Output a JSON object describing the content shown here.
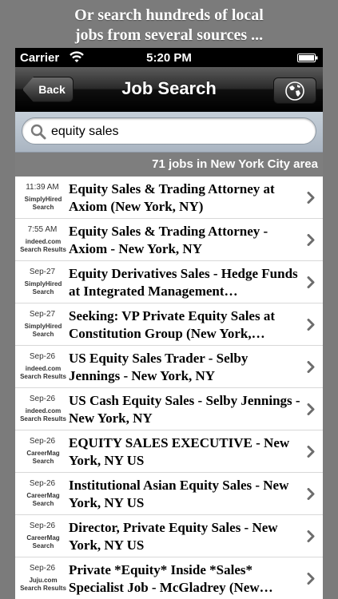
{
  "promo": {
    "line1": "Or search hundreds of local",
    "line2": "jobs from several sources ..."
  },
  "status": {
    "carrier": "Carrier",
    "time": "5:20 PM"
  },
  "nav": {
    "back_label": "Back",
    "title": "Job Search",
    "globe_icon": "globe-icon"
  },
  "search": {
    "value": "equity sales",
    "icon": "magnifier-icon"
  },
  "summary": "71 jobs in New York City area",
  "jobs": [
    {
      "date": "11:39 AM",
      "source1": "SimplyHired",
      "source2": "Search",
      "title": "Equity Sales & Trading Attorney at Axiom (New York, NY)"
    },
    {
      "date": "7:55 AM",
      "source1": "indeed.com",
      "source2": "Search Results",
      "title": "Equity Sales & Trading Attorney - Axiom - New York, NY"
    },
    {
      "date": "Sep-27",
      "source1": "SimplyHired",
      "source2": "Search",
      "title": "Equity Derivatives Sales - Hedge Funds at Integrated Management…"
    },
    {
      "date": "Sep-27",
      "source1": "SimplyHired",
      "source2": "Search",
      "title": "Seeking: VP Private Equity Sales at Constitution Group (New York,…"
    },
    {
      "date": "Sep-26",
      "source1": "indeed.com",
      "source2": "Search Results",
      "title": "US Equity Sales Trader - Selby Jennings - New York, NY"
    },
    {
      "date": "Sep-26",
      "source1": "indeed.com",
      "source2": "Search Results",
      "title": "US Cash Equity Sales - Selby Jennings - New York, NY"
    },
    {
      "date": "Sep-26",
      "source1": "CareerMag",
      "source2": "Search",
      "title": "EQUITY SALES EXECUTIVE - New York, NY US"
    },
    {
      "date": "Sep-26",
      "source1": "CareerMag",
      "source2": "Search",
      "title": "Institutional Asian Equity Sales - New York, NY US"
    },
    {
      "date": "Sep-26",
      "source1": "CareerMag",
      "source2": "Search",
      "title": "Director, Private Equity Sales - New York, NY US"
    },
    {
      "date": "Sep-26",
      "source1": "Juju.com",
      "source2": "Search Results",
      "title": "Private *Equity* Inside *Sales* Specialist Job - McGladrey (New…"
    }
  ]
}
